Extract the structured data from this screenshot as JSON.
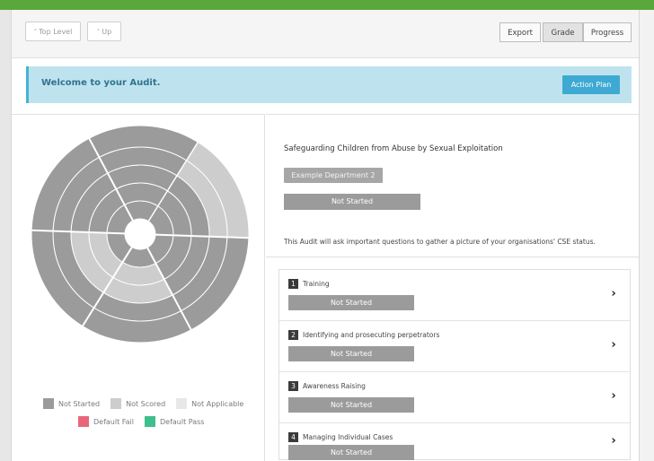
{
  "toolbar": {
    "top_level": "Top Level",
    "top_level_icon": "up-double-chevron-icon",
    "up": "Up",
    "up_icon": "up-chevron-icon",
    "export": "Export",
    "grade": "Grade",
    "progress": "Progress",
    "active_view": "Grade"
  },
  "welcome": {
    "text": "Welcome to your Audit.",
    "action_plan": "Action Plan"
  },
  "audit": {
    "title": "Safeguarding Children from Abuse by Sexual Exploitation",
    "department": "Example Department 2",
    "status": "Not Started",
    "description": "This Audit will ask important questions to gather a picture of your organisations' CSE status."
  },
  "legend": [
    {
      "label": "Not Started",
      "color": "#9b9b9b"
    },
    {
      "label": "Not Scored",
      "color": "#cdcdcd"
    },
    {
      "label": "Not Applicable",
      "color": "#e8e8e8"
    },
    {
      "label": "Default Fail",
      "color": "#e8667a"
    },
    {
      "label": "Default Pass",
      "color": "#3fbf8e"
    }
  ],
  "colors": {
    "not_started": "#9b9b9b",
    "not_scored": "#cdcdcd",
    "accent": "#3eaad3",
    "top_bar": "#5aa73c"
  },
  "sections": [
    {
      "number": "1",
      "name": "Training",
      "status": "Not Started"
    },
    {
      "number": "2",
      "name": "Identifying and prosecuting perpetrators",
      "status": "Not Started"
    },
    {
      "number": "3",
      "name": "Awareness Raising",
      "status": "Not Started"
    },
    {
      "number": "4",
      "name": "Managing Individual Cases",
      "status": "Not Started"
    }
  ]
}
